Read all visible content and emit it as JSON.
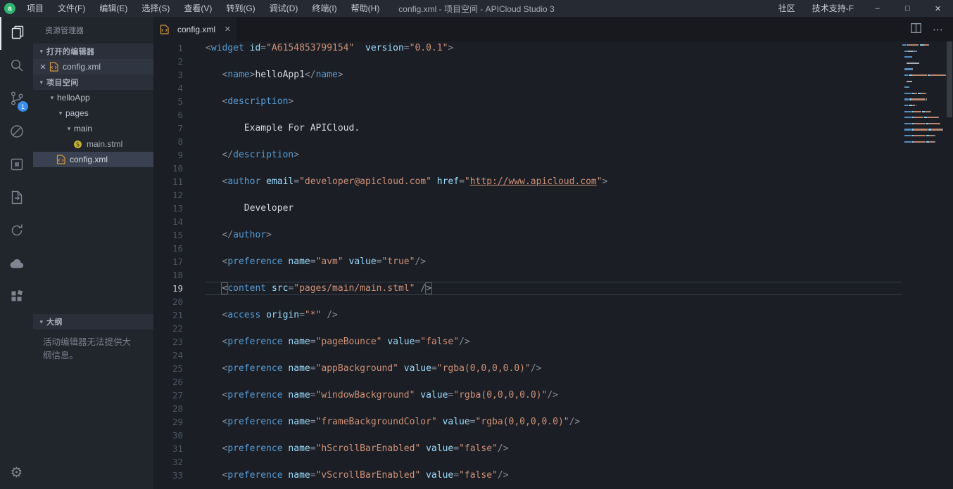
{
  "title_bar": {
    "app_name": "APICloud Studio 3",
    "menus": [
      "项目",
      "文件(F)",
      "编辑(E)",
      "选择(S)",
      "查看(V)",
      "转到(G)",
      "调试(D)",
      "终端(I)",
      "帮助(H)"
    ],
    "window_title": "config.xml - 项目空间 - APICloud Studio 3",
    "community_label": "社区",
    "support_label": "技术支持-F",
    "window_controls": {
      "minimize": "–",
      "maximize": "□",
      "close": "✕"
    }
  },
  "activity_bar": {
    "items": [
      {
        "name": "explorer-icon",
        "active": true
      },
      {
        "name": "search-icon"
      },
      {
        "name": "source-control-icon",
        "badge": "1"
      },
      {
        "name": "blocked-circle-icon"
      },
      {
        "name": "app-window-icon"
      },
      {
        "name": "export-page-icon"
      },
      {
        "name": "sync-icon"
      },
      {
        "name": "cloud-icon"
      },
      {
        "name": "plugins-icon"
      }
    ],
    "bottom_items": [
      {
        "name": "settings-gear-icon",
        "glyph": "⚙"
      }
    ]
  },
  "sidebar": {
    "title": "资源管理器",
    "sections": {
      "open_editors": {
        "label": "打开的编辑器"
      },
      "project": {
        "label": "项目空间"
      },
      "outline": {
        "label": "大纲",
        "message": "活动编辑器无法提供大纲信息。"
      }
    },
    "open_editor_items": [
      {
        "label": "config.xml",
        "icon": "xml"
      }
    ],
    "tree": [
      {
        "label": "helloApp",
        "depth": 0,
        "type": "folder",
        "expanded": true
      },
      {
        "label": "pages",
        "depth": 1,
        "type": "folder",
        "expanded": true
      },
      {
        "label": "main",
        "depth": 2,
        "type": "folder",
        "expanded": true
      },
      {
        "label": "main.stml",
        "depth": 3,
        "type": "stml"
      },
      {
        "label": "config.xml",
        "depth": 1,
        "type": "xml",
        "selected": true
      }
    ]
  },
  "editor": {
    "tabs": [
      {
        "label": "config.xml",
        "icon": "xml",
        "active": true
      }
    ],
    "active_line": 19,
    "token_colors": {
      "p": "#8a8f98",
      "t": "#569cd6",
      "a": "#9cdcfe",
      "s": "#ce9178",
      "u": "#ce9178",
      "x": "#b9bfc9",
      "m": "#9aa1ad"
    },
    "lines": [
      [
        [
          "p",
          "<"
        ],
        [
          "t",
          "widget"
        ],
        [
          "x",
          " "
        ],
        [
          "a",
          "id"
        ],
        [
          "p",
          "="
        ],
        [
          "s",
          "\"A6154853799154\""
        ],
        [
          "x",
          "  "
        ],
        [
          "a",
          "version"
        ],
        [
          "p",
          "="
        ],
        [
          "s",
          "\"0.0.1\""
        ],
        [
          "p",
          ">"
        ]
      ],
      [],
      [
        [
          "x",
          "   "
        ],
        [
          "p",
          "<"
        ],
        [
          "t",
          "name"
        ],
        [
          "p",
          ">"
        ],
        [
          "x",
          "helloApp1"
        ],
        [
          "p",
          "</"
        ],
        [
          "t",
          "name"
        ],
        [
          "p",
          ">"
        ]
      ],
      [],
      [
        [
          "x",
          "   "
        ],
        [
          "p",
          "<"
        ],
        [
          "t",
          "description"
        ],
        [
          "p",
          ">"
        ]
      ],
      [],
      [
        [
          "x",
          "       Example For APICloud."
        ]
      ],
      [],
      [
        [
          "x",
          "   "
        ],
        [
          "p",
          "</"
        ],
        [
          "t",
          "description"
        ],
        [
          "p",
          ">"
        ]
      ],
      [],
      [
        [
          "x",
          "   "
        ],
        [
          "p",
          "<"
        ],
        [
          "t",
          "author"
        ],
        [
          "x",
          " "
        ],
        [
          "a",
          "email"
        ],
        [
          "p",
          "="
        ],
        [
          "s",
          "\"developer@apicloud.com\""
        ],
        [
          "x",
          " "
        ],
        [
          "a",
          "href"
        ],
        [
          "p",
          "="
        ],
        [
          "s",
          "\""
        ],
        [
          "u",
          "http://www.apicloud.com"
        ],
        [
          "s",
          "\""
        ],
        [
          "p",
          ">"
        ]
      ],
      [],
      [
        [
          "x",
          "       Developer"
        ]
      ],
      [],
      [
        [
          "x",
          "   "
        ],
        [
          "p",
          "</"
        ],
        [
          "t",
          "author"
        ],
        [
          "p",
          ">"
        ]
      ],
      [],
      [
        [
          "x",
          "   "
        ],
        [
          "p",
          "<"
        ],
        [
          "t",
          "preference"
        ],
        [
          "x",
          " "
        ],
        [
          "a",
          "name"
        ],
        [
          "p",
          "="
        ],
        [
          "s",
          "\"avm\""
        ],
        [
          "x",
          " "
        ],
        [
          "a",
          "value"
        ],
        [
          "p",
          "="
        ],
        [
          "s",
          "\"true\""
        ],
        [
          "p",
          "/>"
        ]
      ],
      [],
      [
        [
          "x",
          "   "
        ],
        [
          "m",
          "<"
        ],
        [
          "t",
          "content"
        ],
        [
          "x",
          " "
        ],
        [
          "a",
          "src"
        ],
        [
          "p",
          "="
        ],
        [
          "s",
          "\"pages/main/main.stml\""
        ],
        [
          "x",
          " "
        ],
        [
          "p",
          "/"
        ],
        [
          "m",
          ">"
        ]
      ],
      [],
      [
        [
          "x",
          "   "
        ],
        [
          "p",
          "<"
        ],
        [
          "t",
          "access"
        ],
        [
          "x",
          " "
        ],
        [
          "a",
          "origin"
        ],
        [
          "p",
          "="
        ],
        [
          "s",
          "\"*\""
        ],
        [
          "x",
          " "
        ],
        [
          "p",
          "/>"
        ]
      ],
      [],
      [
        [
          "x",
          "   "
        ],
        [
          "p",
          "<"
        ],
        [
          "t",
          "preference"
        ],
        [
          "x",
          " "
        ],
        [
          "a",
          "name"
        ],
        [
          "p",
          "="
        ],
        [
          "s",
          "\"pageBounce\""
        ],
        [
          "x",
          " "
        ],
        [
          "a",
          "value"
        ],
        [
          "p",
          "="
        ],
        [
          "s",
          "\"false\""
        ],
        [
          "p",
          "/>"
        ]
      ],
      [],
      [
        [
          "x",
          "   "
        ],
        [
          "p",
          "<"
        ],
        [
          "t",
          "preference"
        ],
        [
          "x",
          " "
        ],
        [
          "a",
          "name"
        ],
        [
          "p",
          "="
        ],
        [
          "s",
          "\"appBackground\""
        ],
        [
          "x",
          " "
        ],
        [
          "a",
          "value"
        ],
        [
          "p",
          "="
        ],
        [
          "s",
          "\"rgba(0,0,0,0.0)\""
        ],
        [
          "p",
          "/>"
        ]
      ],
      [],
      [
        [
          "x",
          "   "
        ],
        [
          "p",
          "<"
        ],
        [
          "t",
          "preference"
        ],
        [
          "x",
          " "
        ],
        [
          "a",
          "name"
        ],
        [
          "p",
          "="
        ],
        [
          "s",
          "\"windowBackground\""
        ],
        [
          "x",
          " "
        ],
        [
          "a",
          "value"
        ],
        [
          "p",
          "="
        ],
        [
          "s",
          "\"rgba(0,0,0,0.0)\""
        ],
        [
          "p",
          "/>"
        ]
      ],
      [],
      [
        [
          "x",
          "   "
        ],
        [
          "p",
          "<"
        ],
        [
          "t",
          "preference"
        ],
        [
          "x",
          " "
        ],
        [
          "a",
          "name"
        ],
        [
          "p",
          "="
        ],
        [
          "s",
          "\"frameBackgroundColor\""
        ],
        [
          "x",
          " "
        ],
        [
          "a",
          "value"
        ],
        [
          "p",
          "="
        ],
        [
          "s",
          "\"rgba(0,0,0,0.0)\""
        ],
        [
          "p",
          "/>"
        ]
      ],
      [],
      [
        [
          "x",
          "   "
        ],
        [
          "p",
          "<"
        ],
        [
          "t",
          "preference"
        ],
        [
          "x",
          " "
        ],
        [
          "a",
          "name"
        ],
        [
          "p",
          "="
        ],
        [
          "s",
          "\"hScrollBarEnabled\""
        ],
        [
          "x",
          " "
        ],
        [
          "a",
          "value"
        ],
        [
          "p",
          "="
        ],
        [
          "s",
          "\"false\""
        ],
        [
          "p",
          "/>"
        ]
      ],
      [],
      [
        [
          "x",
          "   "
        ],
        [
          "p",
          "<"
        ],
        [
          "t",
          "preference"
        ],
        [
          "x",
          " "
        ],
        [
          "a",
          "name"
        ],
        [
          "p",
          "="
        ],
        [
          "s",
          "\"vScrollBarEnabled\""
        ],
        [
          "x",
          " "
        ],
        [
          "a",
          "value"
        ],
        [
          "p",
          "="
        ],
        [
          "s",
          "\"false\""
        ],
        [
          "p",
          "/>"
        ]
      ]
    ]
  }
}
